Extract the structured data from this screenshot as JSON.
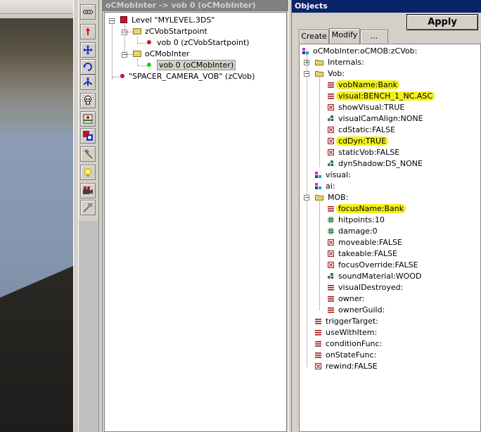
{
  "tree_panel": {
    "title": "oCMobInter -> vob 0 (oCMobInter)",
    "nodes": [
      {
        "label": "Level \"MYLEVEL.3DS\""
      },
      {
        "label": "zCVobStartpoint"
      },
      {
        "label": "vob 0 (zCVobStartpoint)"
      },
      {
        "label": "oCMobInter"
      },
      {
        "label": "vob 0 (oCMobInter)"
      },
      {
        "label": "\"SPACER_CAMERA_VOB\" (zCVob)"
      }
    ]
  },
  "objects_panel": {
    "title": "Objects",
    "apply_label": "Apply",
    "tabs": [
      {
        "label": "Create",
        "active": false
      },
      {
        "label": "Modify",
        "active": true
      },
      {
        "label": "...",
        "active": false
      }
    ],
    "properties": [
      {
        "label": "oCMobInter:oCMOB:zCVob:",
        "icon": "class-icon"
      },
      {
        "label": "Internals:",
        "icon": "folder-icon"
      },
      {
        "label": "Vob:",
        "icon": "folder-icon"
      },
      {
        "label": "vobName:Bank",
        "icon": "string-icon",
        "highlight": true
      },
      {
        "label": "visual:BENCH_1_NC.ASC",
        "icon": "string-icon",
        "highlight": true
      },
      {
        "label": "showVisual:TRUE",
        "icon": "bool-icon"
      },
      {
        "label": "visualCamAlign:NONE",
        "icon": "enum-icon"
      },
      {
        "label": "cdStatic:FALSE",
        "icon": "bool-icon"
      },
      {
        "label": "cdDyn:TRUE",
        "icon": "bool-icon",
        "highlight": true
      },
      {
        "label": "staticVob:FALSE",
        "icon": "bool-icon"
      },
      {
        "label": "dynShadow:DS_NONE",
        "icon": "enum-icon"
      },
      {
        "label": "visual:",
        "icon": "class-icon"
      },
      {
        "label": "ai:",
        "icon": "class-icon"
      },
      {
        "label": "MOB:",
        "icon": "folder-icon"
      },
      {
        "label": "focusName:Bank",
        "icon": "string-icon",
        "highlight": true
      },
      {
        "label": "hitpoints:10",
        "icon": "int-icon"
      },
      {
        "label": "damage:0",
        "icon": "int-icon"
      },
      {
        "label": "moveable:FALSE",
        "icon": "bool-icon"
      },
      {
        "label": "takeable:FALSE",
        "icon": "bool-icon"
      },
      {
        "label": "focusOverride:FALSE",
        "icon": "bool-icon"
      },
      {
        "label": "soundMaterial:WOOD",
        "icon": "enum-icon"
      },
      {
        "label": "visualDestroyed:",
        "icon": "string-icon"
      },
      {
        "label": "owner:",
        "icon": "string-icon"
      },
      {
        "label": "ownerGuild:",
        "icon": "string-icon"
      },
      {
        "label": "triggerTarget:",
        "icon": "string-icon"
      },
      {
        "label": "useWithItem:",
        "icon": "string-icon"
      },
      {
        "label": "conditionFunc:",
        "icon": "string-icon"
      },
      {
        "label": "onStateFunc:",
        "icon": "string-icon"
      },
      {
        "label": "rewind:FALSE",
        "icon": "bool-icon"
      }
    ]
  },
  "colors": {
    "highlight": "#f4f01a",
    "title_active": "#0a246a",
    "title_inactive": "#808080"
  }
}
